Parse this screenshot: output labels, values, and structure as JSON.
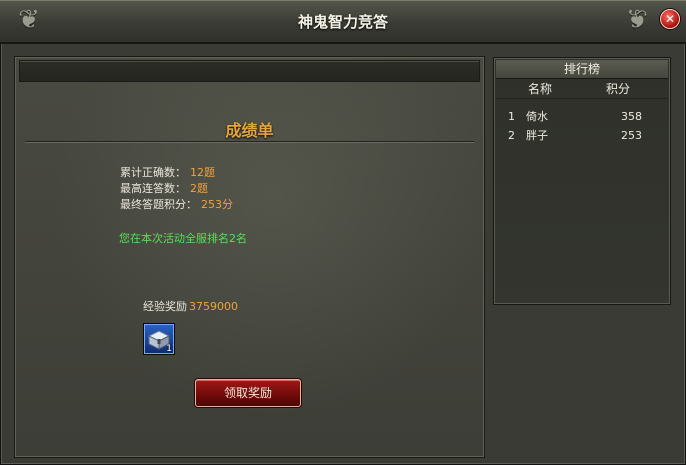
{
  "window": {
    "title": "神鬼智力竞答"
  },
  "score_panel": {
    "heading": "成绩单",
    "stats": [
      {
        "label": "累计正确数：",
        "value": "12题"
      },
      {
        "label": "最高连答数：",
        "value": "2题"
      },
      {
        "label": "最终答题积分：",
        "value": "253分"
      }
    ],
    "rank_message": "您在本次活动全服排名2名",
    "reward": {
      "label": "经验奖励",
      "value": "3759000"
    },
    "reward_item": {
      "icon": "silver-chest-icon",
      "count": "1"
    },
    "claim_button": "领取奖励"
  },
  "leaderboard": {
    "title": "排行榜",
    "columns": {
      "name": "名称",
      "score": "积分"
    },
    "rows": [
      {
        "rank": "1",
        "name": "倚水",
        "score": "358"
      },
      {
        "rank": "2",
        "name": "胖子",
        "score": "253"
      }
    ]
  },
  "colors": {
    "accent_gold": "#e4a53a",
    "value_orange": "#f0a23b",
    "rank_green": "#57e05a",
    "button_red": "#8a0f0e"
  }
}
